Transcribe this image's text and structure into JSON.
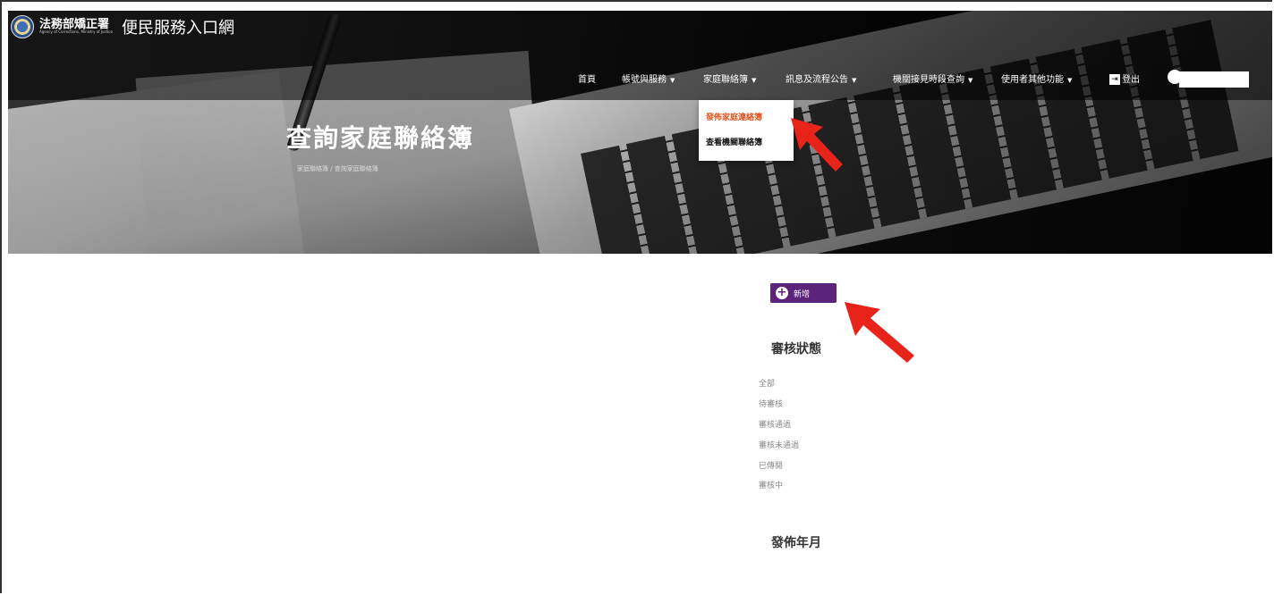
{
  "header": {
    "org_name": "法務部矯正署",
    "org_english": "Agency of Corrections, Ministry of Justice",
    "portal_title": "便民服務入口網"
  },
  "nav": {
    "home": "首頁",
    "account": "帳號與服務",
    "family_book": "家庭聯絡簿",
    "news": "訊息及流程公告",
    "visit_query": "機關接見時段查詢",
    "other": "使用者其他功能",
    "logout": "登出"
  },
  "dropdown": {
    "items": [
      "發佈家庭連絡簿",
      "查看機關聯絡簿"
    ]
  },
  "hero": {
    "title": "查詢家庭聯絡簿",
    "breadcrumb": "家庭聯絡簿 / 查詢家庭聯絡簿"
  },
  "content": {
    "add_button": "新增",
    "status_title": "審核狀態",
    "status_options": [
      "全部",
      "待審核",
      "審核通過",
      "審核未通過",
      "已傳閱",
      "審核中"
    ],
    "date_title": "發佈年月"
  },
  "colors": {
    "accent_purple": "#5b237a",
    "dropdown_active": "#e0551f",
    "annotation_arrow": "#e8231a"
  }
}
